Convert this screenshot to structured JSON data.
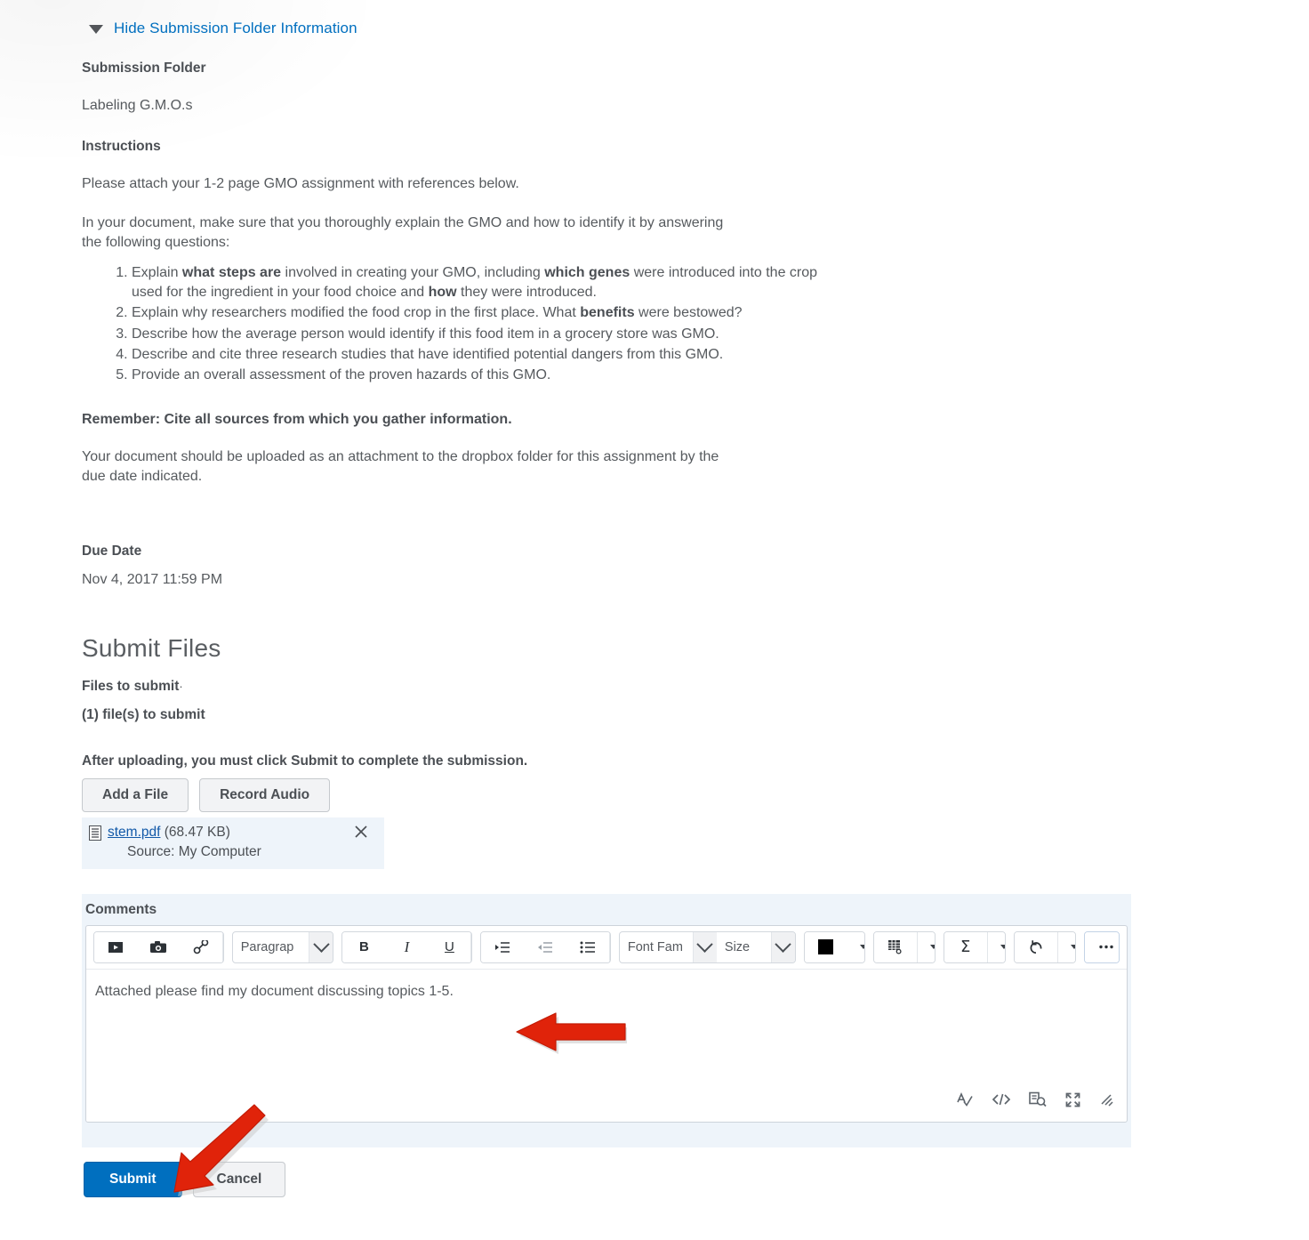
{
  "toggle": {
    "label": "Hide Submission Folder Information",
    "icon": "caret-down-icon",
    "link_color": "#006fbf"
  },
  "folder": {
    "heading": "Submission Folder",
    "name": "Labeling G.M.O.s"
  },
  "instructions": {
    "heading": "Instructions",
    "paragraph1": "Please attach your 1-2 page GMO assignment with references below.",
    "paragraph2": "In your document, make sure that you thoroughly explain the GMO and how to identify it by answering the following questions:",
    "questions": [
      {
        "parts": [
          {
            "text": "Explain ",
            "bold": false
          },
          {
            "text": "what steps are",
            "bold": true
          },
          {
            "text": " involved in creating your GMO, including ",
            "bold": false
          },
          {
            "text": "which genes",
            "bold": true
          },
          {
            "text": " were introduced into the crop used for the ingredient in your food choice and ",
            "bold": false
          },
          {
            "text": "how",
            "bold": true
          },
          {
            "text": " they were introduced.",
            "bold": false
          }
        ]
      },
      {
        "parts": [
          {
            "text": "Explain why researchers modified the food crop in the first place. What ",
            "bold": false
          },
          {
            "text": "benefits",
            "bold": true
          },
          {
            "text": " were bestowed?",
            "bold": false
          }
        ]
      },
      {
        "parts": [
          {
            "text": "Describe how the average person would identify if this food item in a grocery store was GMO.",
            "bold": false
          }
        ]
      },
      {
        "parts": [
          {
            "text": "Describe and cite three research studies that have identified potential dangers from this GMO.",
            "bold": false
          }
        ]
      },
      {
        "parts": [
          {
            "text": "Provide an overall assessment of the proven hazards of this GMO.",
            "bold": false
          }
        ]
      }
    ],
    "remember": "Remember: Cite all sources from which you gather information.",
    "closing": "Your document should be uploaded as an attachment to the dropbox folder for this assignment by the due date indicated."
  },
  "due_date": {
    "heading": "Due Date",
    "value": "Nov 4, 2017 11:59 PM"
  },
  "submit_files": {
    "title": "Submit Files",
    "files_to_submit_label": "Files to submit",
    "files_to_submit_marker": "·",
    "files_count": "(1) file(s) to submit",
    "after_upload_note": "After uploading, you must click Submit to complete the submission.",
    "add_file_button": "Add a File",
    "record_audio_button": "Record Audio",
    "attachment": {
      "icon": "document-icon",
      "name": "stem.pdf",
      "size": "(68.47 KB)",
      "source": "Source: My Computer",
      "remove_icon": "close-icon"
    }
  },
  "comments": {
    "label": "Comments",
    "editor_text": "Attached please find my document discussing topics 1-5.",
    "toolbar": {
      "insert_media_icon": "video-icon",
      "insert_image_icon": "camera-icon",
      "insert_link_icon": "link-icon",
      "insert_caret_icon": "caret-down-icon",
      "paragraph_style": "Paragrap",
      "paragraph_caret_icon": "chevron-down-icon",
      "bold": "B",
      "italic": "I",
      "underline": "U",
      "format_caret_icon": "caret-down-icon",
      "indent_icon": "indent-icon",
      "outdent_icon": "outdent-icon",
      "list_icon": "bullet-list-icon",
      "list_caret_icon": "caret-down-icon",
      "font_family": "Font Fam",
      "font_family_caret_icon": "chevron-down-icon",
      "font_size": "Size",
      "font_size_caret_icon": "chevron-down-icon",
      "text_color_icon": "color-swatch-icon",
      "text_color_value": "#000000",
      "text_color_caret_icon": "caret-down-icon",
      "table_icon": "table-icon",
      "table_caret_icon": "caret-down-icon",
      "equation_icon": "sigma-icon",
      "equation_caret_icon": "caret-down-icon",
      "undo_icon": "undo-icon",
      "undo_caret_icon": "caret-down-icon",
      "more_icon": "ellipsis-icon"
    },
    "status_bar": {
      "spellcheck_icon": "spellcheck-icon",
      "source_code_icon": "html-code-icon",
      "preview_icon": "preview-find-icon",
      "fullscreen_icon": "fullscreen-icon",
      "resize_icon": "resize-grip-icon"
    }
  },
  "actions": {
    "submit": "Submit",
    "cancel": "Cancel",
    "submit_color": "#006fbf"
  },
  "annotations": {
    "arrow_color": "#e0230a",
    "arrow_comment": "points-left-at-comment-text",
    "arrow_submit": "points-down-left-at-submit-button"
  }
}
